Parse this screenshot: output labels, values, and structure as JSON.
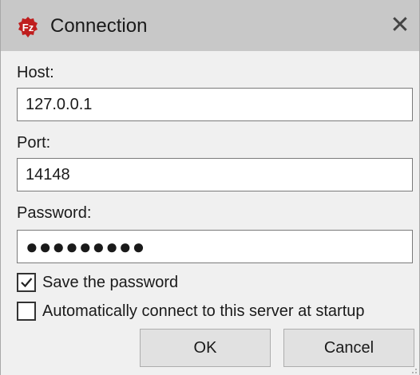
{
  "window": {
    "title": "Connection",
    "app_icon": "filezilla-server-icon",
    "close_glyph": "✕"
  },
  "form": {
    "host_label": "Host:",
    "host_value": "127.0.0.1",
    "port_label": "Port:",
    "port_value": "14148",
    "password_label": "Password:",
    "password_value": "●●●●●●●●●",
    "save_password_label": "Save the password",
    "save_password_checked": true,
    "auto_connect_label": "Automatically connect to this server at startup",
    "auto_connect_checked": false
  },
  "buttons": {
    "ok_label": "OK",
    "cancel_label": "Cancel"
  },
  "colors": {
    "titlebar": "#c8c8c8",
    "window_bg": "#f0f0f0",
    "icon_red": "#bf1e1e"
  }
}
